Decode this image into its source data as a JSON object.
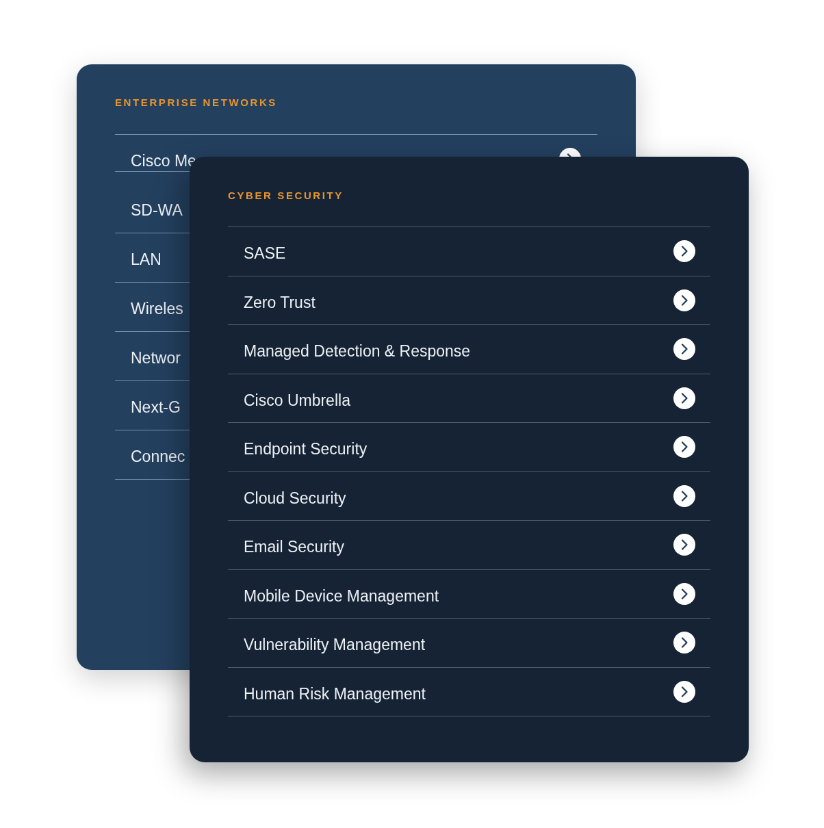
{
  "back_card": {
    "heading": "ENTERPRISE NETWORKS",
    "items": [
      "Cisco Me",
      "SD-WA",
      "LAN",
      "Wireles",
      "Networ",
      "Next-G",
      "Connec"
    ]
  },
  "front_card": {
    "heading": "CYBER SECURITY",
    "items": [
      "SASE",
      "Zero Trust",
      "Managed Detection & Response",
      "Cisco Umbrella",
      "Endpoint Security",
      "Cloud Security",
      "Email Security",
      "Mobile Device Management",
      "Vulnerability Management",
      "Human Risk Management"
    ]
  }
}
